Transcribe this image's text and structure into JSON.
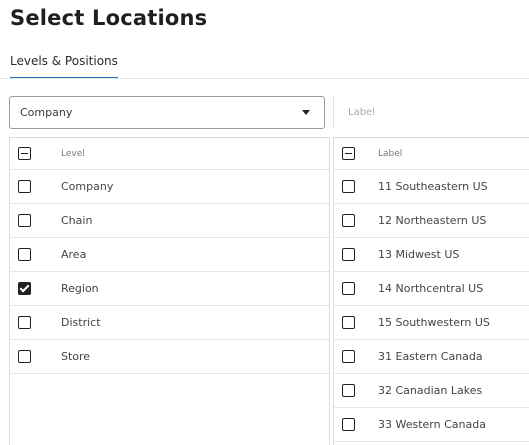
{
  "page": {
    "title": "Select Locations"
  },
  "tabs": [
    {
      "label": "Levels & Positions"
    }
  ],
  "left": {
    "select": {
      "value": "Company"
    },
    "header": {
      "label": "Level",
      "checkbox_state": "partial"
    },
    "rows": [
      {
        "label": "Company",
        "checked": false
      },
      {
        "label": "Chain",
        "checked": false
      },
      {
        "label": "Area",
        "checked": false
      },
      {
        "label": "Region",
        "checked": true
      },
      {
        "label": "District",
        "checked": false
      },
      {
        "label": "Store",
        "checked": false
      }
    ]
  },
  "right": {
    "search": {
      "placeholder": "Label"
    },
    "header": {
      "label": "Label",
      "checkbox_state": "partial"
    },
    "rows": [
      {
        "label": "11 Southeastern US",
        "checked": false
      },
      {
        "label": "12 Northeastern US",
        "checked": false
      },
      {
        "label": "13 Midwest US",
        "checked": false
      },
      {
        "label": "14 Northcentral US",
        "checked": false
      },
      {
        "label": "15 Southwestern US",
        "checked": false
      },
      {
        "label": "31 Eastern Canada",
        "checked": false
      },
      {
        "label": "32 Canadian Lakes",
        "checked": false
      },
      {
        "label": "33 Western Canada",
        "checked": false
      }
    ]
  }
}
